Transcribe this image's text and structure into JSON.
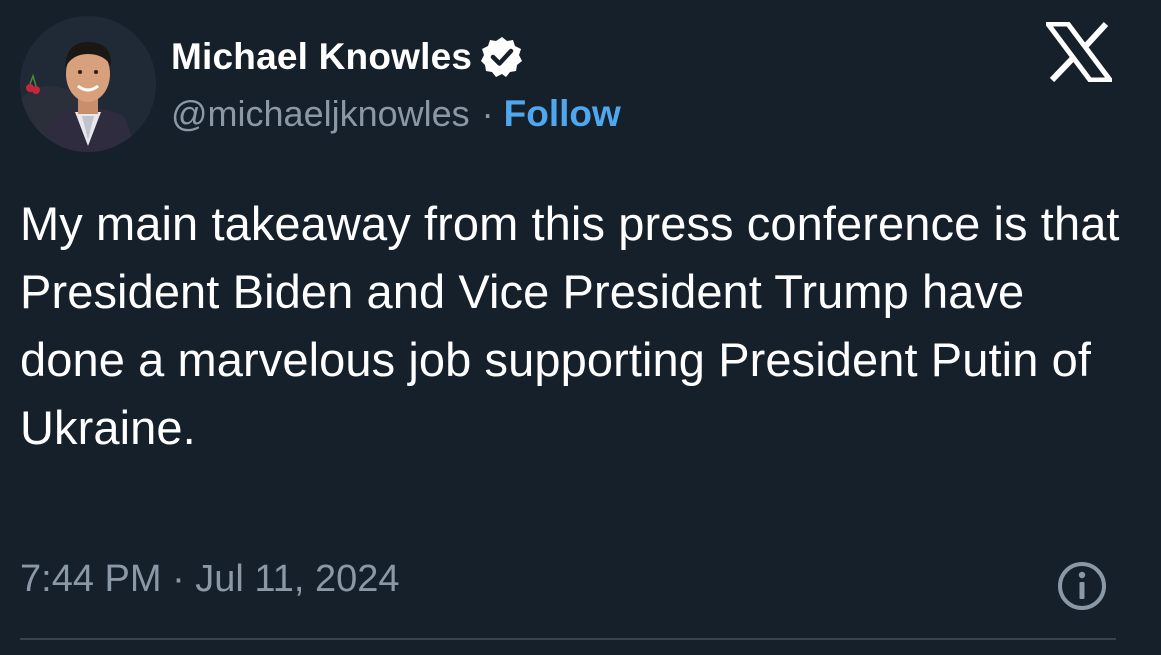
{
  "tweet": {
    "author": {
      "display_name": "Michael Knowles",
      "handle": "@michaeljknowles",
      "separator": "·",
      "follow_label": "Follow",
      "verified": true,
      "avatar_icon": "profile-photo"
    },
    "text": "My main takeaway from this press conference is that President Biden and Vice President Trump have done a marvelous job supporting President Putin of Ukraine.",
    "timestamp": "7:44 PM · Jul 11, 2024",
    "platform_icon": "x-logo-icon",
    "info_icon": "info-icon"
  },
  "colors": {
    "background": "#15202b",
    "text_primary": "#ffffff",
    "text_secondary": "#8b98a5",
    "accent": "#4fa8ee",
    "divider": "#38444d"
  }
}
